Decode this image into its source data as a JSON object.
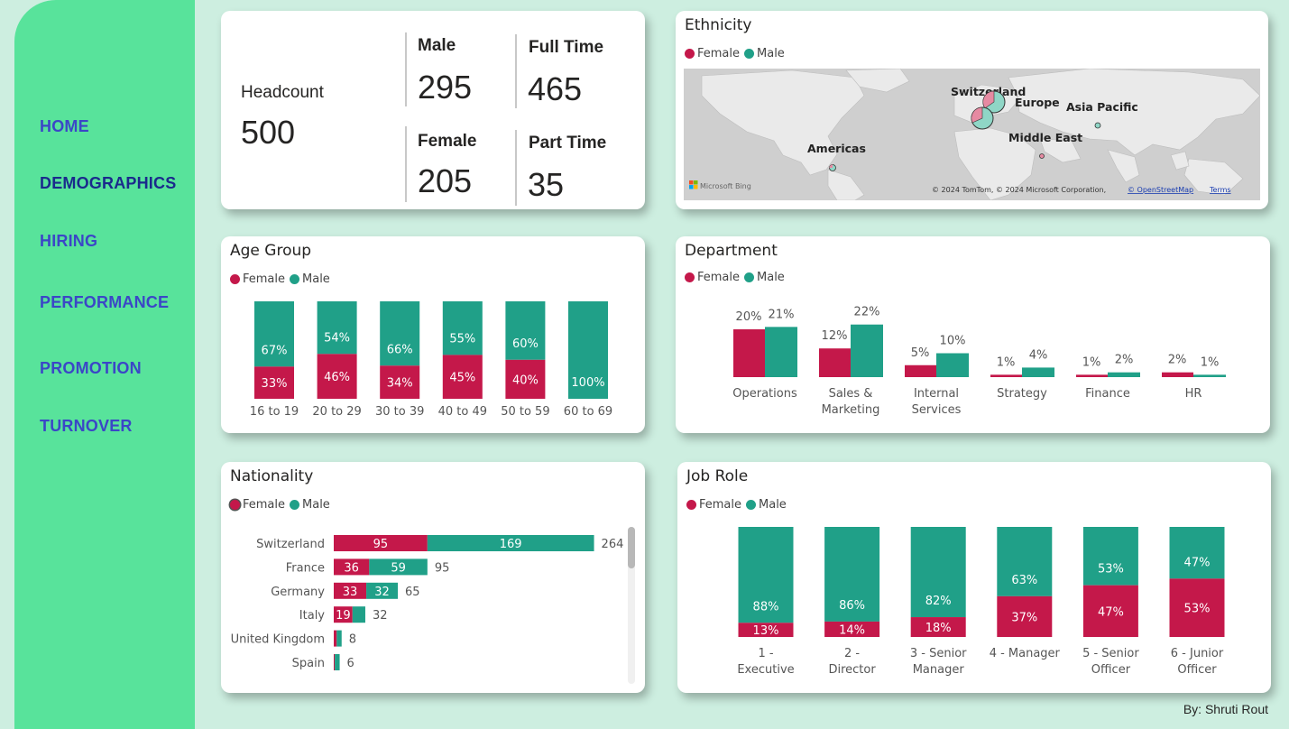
{
  "nav": {
    "items": [
      {
        "label": "HOME"
      },
      {
        "label": "DEMOGRAPHICS"
      },
      {
        "label": "HIRING"
      },
      {
        "label": "PERFORMANCE"
      },
      {
        "label": "PROMOTION"
      },
      {
        "label": "TURNOVER"
      }
    ],
    "active": "DEMOGRAPHICS"
  },
  "colors": {
    "female": "#c4184a",
    "male": "#20a088",
    "sidebar": "#58e39b",
    "nav_text": "#3b46c7"
  },
  "legend": {
    "female": "Female",
    "male": "Male"
  },
  "kpis": {
    "headcount_label": "Headcount",
    "headcount_value": "500",
    "male_label": "Male",
    "male_value": "295",
    "female_label": "Female",
    "female_value": "205",
    "fulltime_label": "Full Time",
    "fulltime_value": "465",
    "parttime_label": "Part Time",
    "parttime_value": "35"
  },
  "ethnicity": {
    "title": "Ethnicity",
    "regions": [
      "Switzerland",
      "Europe",
      "Asia Pacific",
      "Middle East",
      "Americas"
    ],
    "attribution": "© 2024 TomTom, © 2024 Microsoft Corporation,",
    "osm_link": "© OpenStreetMap",
    "terms_link": "Terms",
    "bing_logo": "Microsoft Bing"
  },
  "chart_data": [
    {
      "id": "age",
      "title": "Age Group",
      "type": "bar",
      "stacked": "100%",
      "categories": [
        "16 to 19",
        "20 to 29",
        "30 to 39",
        "40 to 49",
        "50 to 59",
        "60 to 69"
      ],
      "series": [
        {
          "name": "Female",
          "values": [
            33,
            46,
            34,
            45,
            40,
            0
          ]
        },
        {
          "name": "Male",
          "values": [
            67,
            54,
            66,
            55,
            60,
            100
          ]
        }
      ]
    },
    {
      "id": "department",
      "title": "Department",
      "type": "bar",
      "categories": [
        "Operations",
        "Sales & Marketing",
        "Internal Services",
        "Strategy",
        "Finance",
        "HR"
      ],
      "series": [
        {
          "name": "Female",
          "values": [
            20,
            12,
            5,
            1,
            1,
            2
          ]
        },
        {
          "name": "Male",
          "values": [
            21,
            22,
            10,
            4,
            2,
            1
          ]
        }
      ]
    },
    {
      "id": "nationality",
      "title": "Nationality",
      "type": "bar",
      "orientation": "horizontal",
      "stacked": true,
      "categories": [
        "Switzerland",
        "France",
        "Germany",
        "Italy",
        "United Kingdom",
        "Spain"
      ],
      "series": [
        {
          "name": "Female",
          "values": [
            95,
            36,
            33,
            19,
            3,
            1
          ]
        },
        {
          "name": "Male",
          "values": [
            169,
            59,
            32,
            13,
            5,
            5
          ]
        }
      ],
      "totals": [
        264,
        95,
        65,
        32,
        8,
        6
      ]
    },
    {
      "id": "jobrole",
      "title": "Job Role",
      "type": "bar",
      "stacked": "100%",
      "categories": [
        "1 - Executive",
        "2 - Director",
        "3 - Senior Manager",
        "4 - Manager",
        "5 - Senior Officer",
        "6 - Junior Officer"
      ],
      "series": [
        {
          "name": "Female",
          "values": [
            13,
            14,
            18,
            37,
            47,
            53
          ]
        },
        {
          "name": "Male",
          "values": [
            88,
            86,
            82,
            63,
            53,
            47
          ]
        }
      ]
    }
  ],
  "credit": "By: Shruti Rout"
}
